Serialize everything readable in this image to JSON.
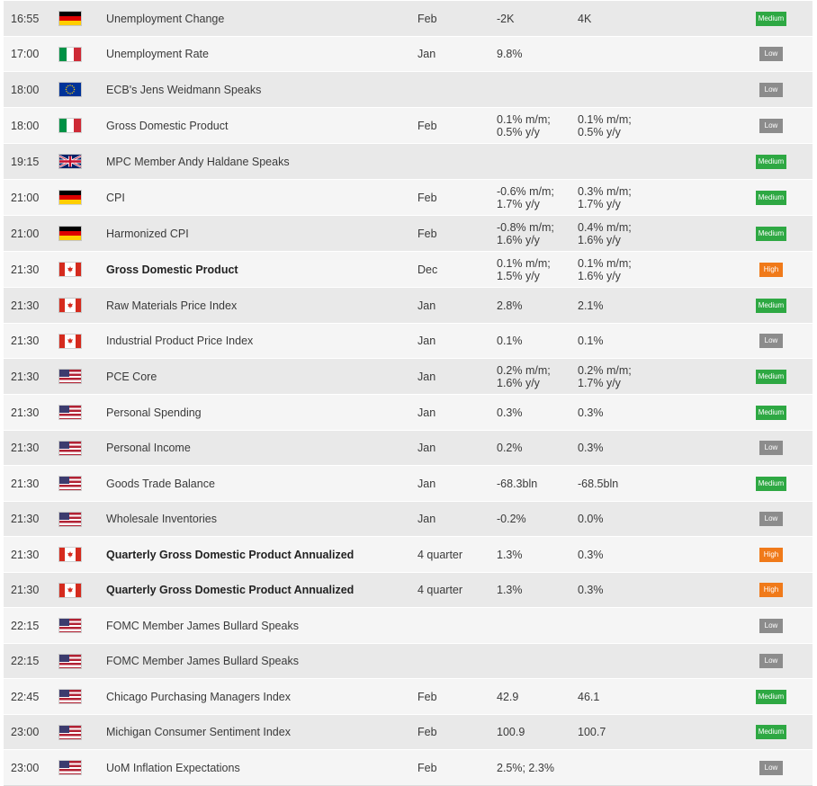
{
  "importance_colors": {
    "Low": "#8c8c8c",
    "Medium": "#2ea843",
    "High": "#f07a1a"
  },
  "rows": [
    {
      "time": "16:55",
      "flag": "de",
      "flag_icon": "germany-flag-icon",
      "event": "Unemployment Change",
      "bold": false,
      "period": "Feb",
      "previous": [
        "-2K"
      ],
      "forecast": [
        "4K"
      ],
      "importance": "Medium"
    },
    {
      "time": "17:00",
      "flag": "it",
      "flag_icon": "italy-flag-icon",
      "event": "Unemployment Rate",
      "bold": false,
      "period": "Jan",
      "previous": [
        "9.8%"
      ],
      "forecast": [],
      "importance": "Low"
    },
    {
      "time": "18:00",
      "flag": "eu",
      "flag_icon": "eu-flag-icon",
      "event": "ECB's Jens Weidmann Speaks",
      "bold": false,
      "period": "",
      "previous": [],
      "forecast": [],
      "importance": "Low"
    },
    {
      "time": "18:00",
      "flag": "it",
      "flag_icon": "italy-flag-icon",
      "event": "Gross Domestic Product",
      "bold": false,
      "period": "Feb",
      "previous": [
        "0.1% m/m;",
        "0.5% y/y"
      ],
      "forecast": [
        "0.1% m/m;",
        "0.5% y/y"
      ],
      "importance": "Low"
    },
    {
      "time": "19:15",
      "flag": "gb",
      "flag_icon": "uk-flag-icon",
      "event": "MPC Member Andy Haldane Speaks",
      "bold": false,
      "period": "",
      "previous": [],
      "forecast": [],
      "importance": "Medium"
    },
    {
      "time": "21:00",
      "flag": "de",
      "flag_icon": "germany-flag-icon",
      "event": "CPI",
      "bold": false,
      "period": "Feb",
      "previous": [
        "-0.6% m/m;",
        "1.7% y/y"
      ],
      "forecast": [
        "0.3% m/m;",
        "1.7% y/y"
      ],
      "importance": "Medium"
    },
    {
      "time": "21:00",
      "flag": "de",
      "flag_icon": "germany-flag-icon",
      "event": "Harmonized CPI",
      "bold": false,
      "period": "Feb",
      "previous": [
        "-0.8% m/m;",
        "1.6% y/y"
      ],
      "forecast": [
        "0.4% m/m;",
        "1.6% y/y"
      ],
      "importance": "Medium"
    },
    {
      "time": "21:30",
      "flag": "ca",
      "flag_icon": "canada-flag-icon",
      "event": "Gross Domestic Product",
      "bold": true,
      "period": "Dec",
      "previous": [
        "0.1% m/m;",
        "1.5% y/y"
      ],
      "forecast": [
        "0.1% m/m;",
        "1.6% y/y"
      ],
      "importance": "High"
    },
    {
      "time": "21:30",
      "flag": "ca",
      "flag_icon": "canada-flag-icon",
      "event": "Raw Materials Price Index",
      "bold": false,
      "period": "Jan",
      "previous": [
        "2.8%"
      ],
      "forecast": [
        "2.1%"
      ],
      "importance": "Medium"
    },
    {
      "time": "21:30",
      "flag": "ca",
      "flag_icon": "canada-flag-icon",
      "event": "Industrial Product Price Index",
      "bold": false,
      "period": "Jan",
      "previous": [
        "0.1%"
      ],
      "forecast": [
        "0.1%"
      ],
      "importance": "Low"
    },
    {
      "time": "21:30",
      "flag": "us",
      "flag_icon": "usa-flag-icon",
      "event": "PCE Core",
      "bold": false,
      "period": "Jan",
      "previous": [
        "0.2% m/m;",
        "1.6% y/y"
      ],
      "forecast": [
        "0.2% m/m;",
        "1.7% y/y"
      ],
      "importance": "Medium"
    },
    {
      "time": "21:30",
      "flag": "us",
      "flag_icon": "usa-flag-icon",
      "event": "Personal Spending",
      "bold": false,
      "period": "Jan",
      "previous": [
        "0.3%"
      ],
      "forecast": [
        "0.3%"
      ],
      "importance": "Medium"
    },
    {
      "time": "21:30",
      "flag": "us",
      "flag_icon": "usa-flag-icon",
      "event": "Personal Income",
      "bold": false,
      "period": "Jan",
      "previous": [
        "0.2%"
      ],
      "forecast": [
        "0.3%"
      ],
      "importance": "Low"
    },
    {
      "time": "21:30",
      "flag": "us",
      "flag_icon": "usa-flag-icon",
      "event": "Goods Trade Balance",
      "bold": false,
      "period": "Jan",
      "previous": [
        "-68.3bln"
      ],
      "forecast": [
        "-68.5bln"
      ],
      "importance": "Medium"
    },
    {
      "time": "21:30",
      "flag": "us",
      "flag_icon": "usa-flag-icon",
      "event": "Wholesale Inventories",
      "bold": false,
      "period": "Jan",
      "previous": [
        "-0.2%"
      ],
      "forecast": [
        "0.0%"
      ],
      "importance": "Low"
    },
    {
      "time": "21:30",
      "flag": "ca",
      "flag_icon": "canada-flag-icon",
      "event": "Quarterly Gross Domestic Product Annualized",
      "bold": true,
      "period": "4 quarter",
      "previous": [
        "1.3%"
      ],
      "forecast": [
        "0.3%"
      ],
      "importance": "High"
    },
    {
      "time": "21:30",
      "flag": "ca",
      "flag_icon": "canada-flag-icon",
      "event": "Quarterly Gross Domestic Product Annualized",
      "bold": true,
      "period": "4 quarter",
      "previous": [
        "1.3%"
      ],
      "forecast": [
        "0.3%"
      ],
      "importance": "High"
    },
    {
      "time": "22:15",
      "flag": "us",
      "flag_icon": "usa-flag-icon",
      "event": "FOMC Member James Bullard Speaks",
      "bold": false,
      "period": "",
      "previous": [],
      "forecast": [],
      "importance": "Low"
    },
    {
      "time": "22:15",
      "flag": "us",
      "flag_icon": "usa-flag-icon",
      "event": "FOMC Member James Bullard Speaks",
      "bold": false,
      "period": "",
      "previous": [],
      "forecast": [],
      "importance": "Low"
    },
    {
      "time": "22:45",
      "flag": "us",
      "flag_icon": "usa-flag-icon",
      "event": "Chicago Purchasing Managers Index",
      "bold": false,
      "period": "Feb",
      "previous": [
        "42.9"
      ],
      "forecast": [
        "46.1"
      ],
      "importance": "Medium"
    },
    {
      "time": "23:00",
      "flag": "us",
      "flag_icon": "usa-flag-icon",
      "event": "Michigan Consumer Sentiment Index",
      "bold": false,
      "period": "Feb",
      "previous": [
        "100.9"
      ],
      "forecast": [
        "100.7"
      ],
      "importance": "Medium"
    },
    {
      "time": "23:00",
      "flag": "us",
      "flag_icon": "usa-flag-icon",
      "event": "UoM Inflation Expectations",
      "bold": false,
      "period": "Feb",
      "previous": [
        "2.5%; 2.3%"
      ],
      "forecast": [],
      "importance": "Low"
    }
  ]
}
